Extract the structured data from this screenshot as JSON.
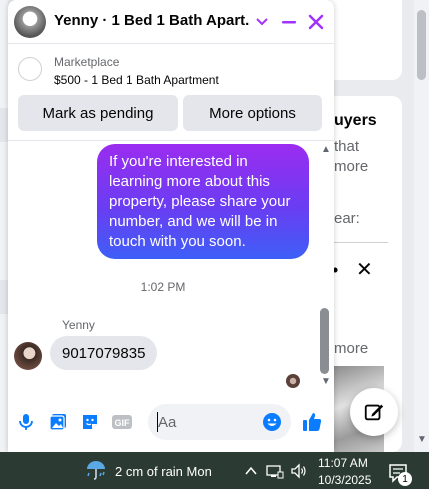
{
  "background": {
    "side_title": "uyers",
    "side_text_1": "that",
    "side_text_2": "more",
    "side_text_3": "ear:",
    "more_link": "more"
  },
  "chat": {
    "title": "Yenny · 1 Bed 1 Bath Apart...",
    "listing": {
      "category": "Marketplace",
      "name": "$500 - 1 Bed 1 Bath Apartment"
    },
    "actions": {
      "pending_label": "Mark as pending",
      "options_label": "More options"
    },
    "messages": {
      "outgoing_text": "If you're interested in learning more about this property, please share your number, and we will be in touch with you soon.",
      "timestamp": "1:02 PM",
      "sender_name": "Yenny",
      "incoming_text": "9017079835"
    },
    "composer": {
      "placeholder": "Aa"
    },
    "colors": {
      "accent": "#a033ff",
      "messenger_blue": "#0a7cff",
      "bubble_gradient_top": "#9b2cf0",
      "bubble_gradient_bottom": "#3e5ff7"
    }
  },
  "taskbar": {
    "weather_text": "2 cm of rain Mon",
    "time": "11:07 AM",
    "date": "10/3/2025",
    "notification_count": "1"
  },
  "icons": [
    "mic-icon",
    "photo-icon",
    "sticker-icon",
    "gif-icon",
    "emoji-icon",
    "like-thumb-icon",
    "minimize-icon",
    "close-icon",
    "chevron-down-icon",
    "compose-icon",
    "rain-icon",
    "wifi-icon",
    "volume-icon",
    "notification-icon"
  ]
}
